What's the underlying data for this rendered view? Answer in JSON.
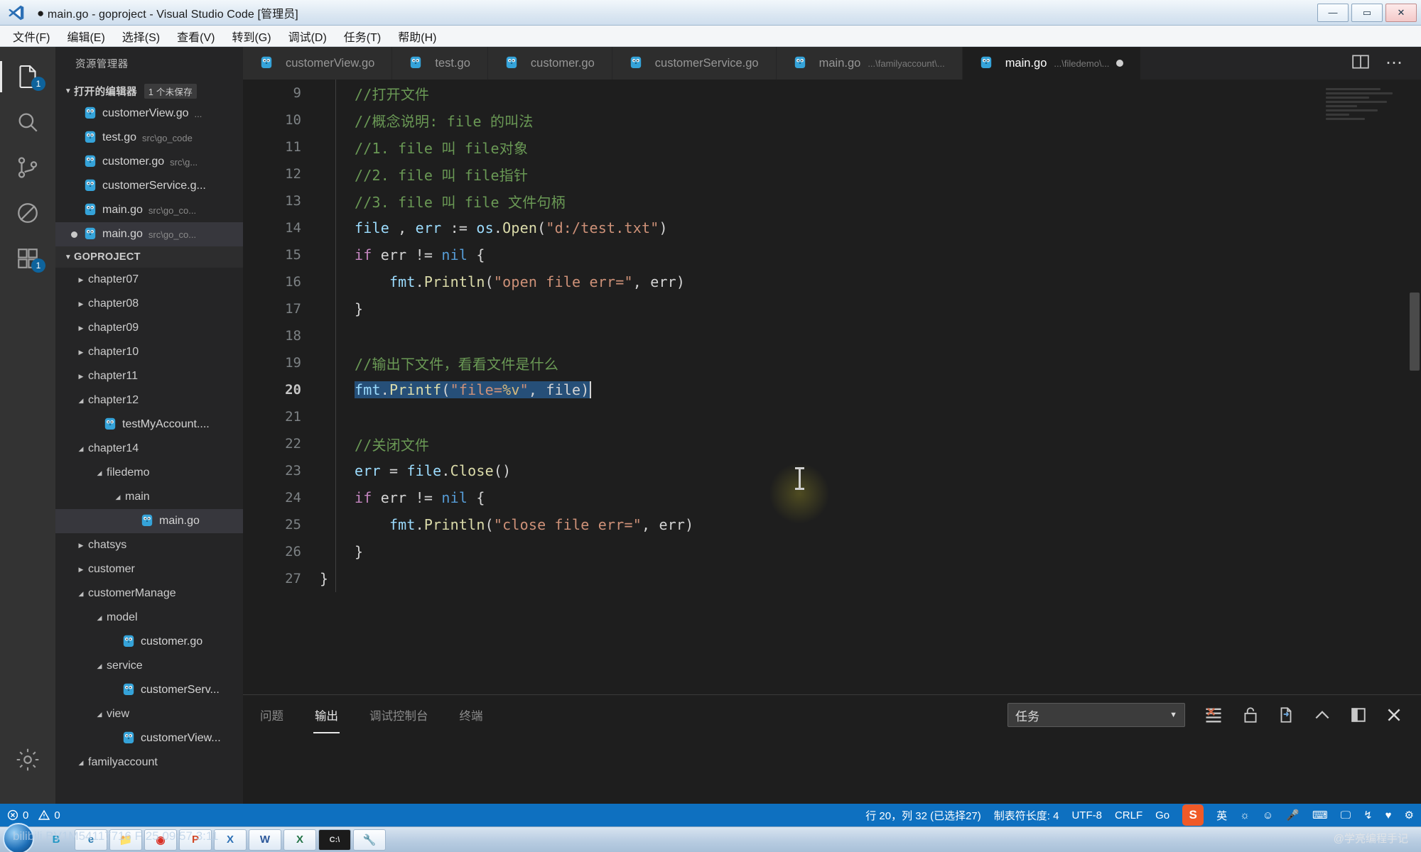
{
  "window": {
    "title": "main.go - goproject - Visual Studio Code [管理员]",
    "modified_dot": "●",
    "minimize": "—",
    "maximize": "▭",
    "close": "✕"
  },
  "menubar": {
    "items": [
      {
        "label": "文件(F)"
      },
      {
        "label": "编辑(E)"
      },
      {
        "label": "选择(S)"
      },
      {
        "label": "查看(V)"
      },
      {
        "label": "转到(G)"
      },
      {
        "label": "调试(D)"
      },
      {
        "label": "任务(T)"
      },
      {
        "label": "帮助(H)"
      }
    ]
  },
  "activitybar": {
    "items": [
      {
        "name": "explorer",
        "icon": "files-icon",
        "badge": "1",
        "active": true
      },
      {
        "name": "search",
        "icon": "search-icon",
        "badge": "",
        "active": false
      },
      {
        "name": "scm",
        "icon": "source-control-icon",
        "badge": "",
        "active": false
      },
      {
        "name": "debug",
        "icon": "debug-icon",
        "badge": "",
        "active": false
      },
      {
        "name": "extensions",
        "icon": "extensions-icon",
        "badge": "1",
        "active": false
      },
      {
        "name": "settings",
        "icon": "gear-icon",
        "badge": "",
        "active": false
      }
    ]
  },
  "sidebar": {
    "title": "资源管理器",
    "open_editors": {
      "label": "打开的编辑器",
      "badge": "1 个未保存",
      "items": [
        {
          "name": "customerView.go",
          "path": "...",
          "modified": false
        },
        {
          "name": "test.go",
          "path": "src\\go_code",
          "modified": false
        },
        {
          "name": "customer.go",
          "path": "src\\g...",
          "modified": false
        },
        {
          "name": "customerService.g...",
          "path": "",
          "modified": false
        },
        {
          "name": "main.go",
          "path": "src\\go_co...",
          "modified": false
        },
        {
          "name": "main.go",
          "path": "src\\go_co...",
          "modified": true
        }
      ]
    },
    "project": {
      "label": "GOPROJECT",
      "tree": [
        {
          "label": "chapter07",
          "type": "folder",
          "expanded": false,
          "depth": 1
        },
        {
          "label": "chapter08",
          "type": "folder",
          "expanded": false,
          "depth": 1
        },
        {
          "label": "chapter09",
          "type": "folder",
          "expanded": false,
          "depth": 1
        },
        {
          "label": "chapter10",
          "type": "folder",
          "expanded": false,
          "depth": 1
        },
        {
          "label": "chapter11",
          "type": "folder",
          "expanded": false,
          "depth": 1
        },
        {
          "label": "chapter12",
          "type": "folder",
          "expanded": true,
          "depth": 1
        },
        {
          "label": "testMyAccount....",
          "type": "file",
          "depth": 2
        },
        {
          "label": "chapter14",
          "type": "folder",
          "expanded": true,
          "depth": 1
        },
        {
          "label": "filedemo",
          "type": "folder",
          "expanded": true,
          "depth": 2
        },
        {
          "label": "main",
          "type": "folder",
          "expanded": true,
          "depth": 3
        },
        {
          "label": "main.go",
          "type": "file",
          "depth": 4,
          "selected": true
        },
        {
          "label": "chatsys",
          "type": "folder",
          "expanded": false,
          "depth": 1
        },
        {
          "label": "customer",
          "type": "folder",
          "expanded": false,
          "depth": 1
        },
        {
          "label": "customerManage",
          "type": "folder",
          "expanded": true,
          "depth": 1
        },
        {
          "label": "model",
          "type": "folder",
          "expanded": true,
          "depth": 2
        },
        {
          "label": "customer.go",
          "type": "file",
          "depth": 3
        },
        {
          "label": "service",
          "type": "folder",
          "expanded": true,
          "depth": 2
        },
        {
          "label": "customerServ...",
          "type": "file",
          "depth": 3
        },
        {
          "label": "view",
          "type": "folder",
          "expanded": true,
          "depth": 2
        },
        {
          "label": "customerView...",
          "type": "file",
          "depth": 3
        },
        {
          "label": "familyaccount",
          "type": "folder",
          "expanded": true,
          "depth": 1
        }
      ]
    }
  },
  "editor_tabs": {
    "tabs": [
      {
        "label": "customerView.go",
        "path": "",
        "active": false,
        "modified": false
      },
      {
        "label": "test.go",
        "path": "",
        "active": false,
        "modified": false
      },
      {
        "label": "customer.go",
        "path": "",
        "active": false,
        "modified": false
      },
      {
        "label": "customerService.go",
        "path": "",
        "active": false,
        "modified": false
      },
      {
        "label": "main.go",
        "path": "...\\familyaccount\\...",
        "active": false,
        "modified": false
      },
      {
        "label": "main.go",
        "path": "...\\filedemo\\...",
        "active": true,
        "modified": true
      }
    ],
    "actions": [
      {
        "name": "split-editor-icon",
        "glyph": "▣"
      },
      {
        "name": "more-actions-icon",
        "glyph": "⋯"
      }
    ]
  },
  "code": {
    "language": "Go",
    "lines": [
      {
        "num": "9",
        "tokens": [
          {
            "t": "//打开文件",
            "c": "cm"
          }
        ],
        "indent": 1
      },
      {
        "num": "10",
        "tokens": [
          {
            "t": "//概念说明: file 的叫法",
            "c": "cm"
          }
        ],
        "indent": 1
      },
      {
        "num": "11",
        "tokens": [
          {
            "t": "//1. file 叫 file对象",
            "c": "cm"
          }
        ],
        "indent": 1
      },
      {
        "num": "12",
        "tokens": [
          {
            "t": "//2. file 叫 file指针",
            "c": "cm"
          }
        ],
        "indent": 1
      },
      {
        "num": "13",
        "tokens": [
          {
            "t": "//3. file 叫 file 文件句柄",
            "c": "cm"
          }
        ],
        "indent": 1
      },
      {
        "num": "14",
        "tokens": [
          {
            "t": "file",
            "c": "id"
          },
          {
            "t": " , ",
            "c": "pk"
          },
          {
            "t": "err",
            "c": "id"
          },
          {
            "t": " := ",
            "c": "pk"
          },
          {
            "t": "os",
            "c": "id"
          },
          {
            "t": ".",
            "c": "pk"
          },
          {
            "t": "Open",
            "c": "fn"
          },
          {
            "t": "(",
            "c": "pk"
          },
          {
            "t": "\"d:/test.txt\"",
            "c": "str"
          },
          {
            "t": ")",
            "c": "pk"
          }
        ],
        "indent": 1
      },
      {
        "num": "15",
        "tokens": [
          {
            "t": "if",
            "c": "kw"
          },
          {
            "t": " err ",
            "c": "pk"
          },
          {
            "t": "!=",
            "c": "pk"
          },
          {
            "t": " ",
            "c": "pk"
          },
          {
            "t": "nil",
            "c": "num"
          },
          {
            "t": " {",
            "c": "pk"
          }
        ],
        "indent": 1
      },
      {
        "num": "16",
        "tokens": [
          {
            "t": "fmt",
            "c": "id"
          },
          {
            "t": ".",
            "c": "pk"
          },
          {
            "t": "Println",
            "c": "fn"
          },
          {
            "t": "(",
            "c": "pk"
          },
          {
            "t": "\"open file err=\"",
            "c": "str"
          },
          {
            "t": ", err)",
            "c": "pk"
          }
        ],
        "indent": 2
      },
      {
        "num": "17",
        "tokens": [
          {
            "t": "}",
            "c": "pk"
          }
        ],
        "indent": 1
      },
      {
        "num": "18",
        "tokens": [],
        "indent": 0
      },
      {
        "num": "19",
        "tokens": [
          {
            "t": "//输出下文件，看看文件是什么",
            "c": "cm"
          }
        ],
        "indent": 1
      },
      {
        "num": "20",
        "tokens": [
          {
            "t": "fmt",
            "c": "id sel"
          },
          {
            "t": ".",
            "c": "pk sel"
          },
          {
            "t": "Printf",
            "c": "fn sel"
          },
          {
            "t": "(",
            "c": "pk sel"
          },
          {
            "t": "\"file=",
            "c": "str sel"
          },
          {
            "t": "%v",
            "c": "pct sel"
          },
          {
            "t": "\"",
            "c": "str sel"
          },
          {
            "t": ", file)",
            "c": "pk sel"
          }
        ],
        "indent": 1,
        "current": true,
        "caret": true
      },
      {
        "num": "21",
        "tokens": [],
        "indent": 0
      },
      {
        "num": "22",
        "tokens": [
          {
            "t": "//关闭文件",
            "c": "cm"
          }
        ],
        "indent": 1
      },
      {
        "num": "23",
        "tokens": [
          {
            "t": "err",
            "c": "id"
          },
          {
            "t": " = ",
            "c": "pk"
          },
          {
            "t": "file",
            "c": "id"
          },
          {
            "t": ".",
            "c": "pk"
          },
          {
            "t": "Close",
            "c": "fn"
          },
          {
            "t": "()",
            "c": "pk"
          }
        ],
        "indent": 1
      },
      {
        "num": "24",
        "tokens": [
          {
            "t": "if",
            "c": "kw"
          },
          {
            "t": " err ",
            "c": "pk"
          },
          {
            "t": "!=",
            "c": "pk"
          },
          {
            "t": " ",
            "c": "pk"
          },
          {
            "t": "nil",
            "c": "num"
          },
          {
            "t": " {",
            "c": "pk"
          }
        ],
        "indent": 1
      },
      {
        "num": "25",
        "tokens": [
          {
            "t": "fmt",
            "c": "id"
          },
          {
            "t": ".",
            "c": "pk"
          },
          {
            "t": "Println",
            "c": "fn"
          },
          {
            "t": "(",
            "c": "pk"
          },
          {
            "t": "\"close file err=\"",
            "c": "str"
          },
          {
            "t": ", err)",
            "c": "pk"
          }
        ],
        "indent": 2
      },
      {
        "num": "26",
        "tokens": [
          {
            "t": "}",
            "c": "pk"
          }
        ],
        "indent": 1
      },
      {
        "num": "27",
        "tokens": [
          {
            "t": "}",
            "c": "pk"
          }
        ],
        "indent": 0
      }
    ]
  },
  "panel": {
    "tabs": [
      {
        "label": "问题",
        "active": false
      },
      {
        "label": "输出",
        "active": true
      },
      {
        "label": "调试控制台",
        "active": false
      },
      {
        "label": "终端",
        "active": false
      }
    ],
    "select_value": "任务",
    "select_arrow": "▼",
    "actions": [
      {
        "name": "clear-output-icon",
        "glyph": "≡"
      },
      {
        "name": "lock-icon",
        "glyph": "🔓"
      },
      {
        "name": "open-in-editor-icon",
        "glyph": "🗎"
      },
      {
        "name": "collapse-panel-icon",
        "glyph": "∧"
      },
      {
        "name": "maximize-panel-icon",
        "glyph": "▯"
      },
      {
        "name": "close-panel-icon",
        "glyph": "✕"
      }
    ]
  },
  "statusbar": {
    "errors_icon": "error-icon",
    "errors": "0",
    "warnings_icon": "warning-icon",
    "warnings": "0",
    "cursor_position": "行 20，列 32 (已选择27)",
    "tab_size": "制表符长度: 4",
    "encoding": "UTF-8",
    "eol": "CRLF",
    "language": "Go",
    "ime": "英",
    "tray": [
      "☼",
      "☺",
      "🎤",
      "⌨",
      "🖵",
      "↯",
      "♥",
      "⚙"
    ]
  },
  "taskbar": {
    "overlay_text": "bilibili BV1M54117716 F 25 09:57 3:11",
    "watermark": "@学亮编程手记",
    "items": [
      {
        "name": "bilibili-icon",
        "glyph": "B"
      },
      {
        "name": "ie-icon",
        "glyph": "e"
      },
      {
        "name": "explorer-icon",
        "glyph": "📁"
      },
      {
        "name": "chrome-icon",
        "glyph": "◉"
      },
      {
        "name": "powerpoint-icon",
        "glyph": "P"
      },
      {
        "name": "vscode-icon",
        "glyph": "X"
      },
      {
        "name": "word-icon",
        "glyph": "W"
      },
      {
        "name": "excel-icon",
        "glyph": "X"
      },
      {
        "name": "cmd-icon",
        "glyph": "C:\\"
      },
      {
        "name": "tool-icon",
        "glyph": "🔧"
      }
    ]
  }
}
